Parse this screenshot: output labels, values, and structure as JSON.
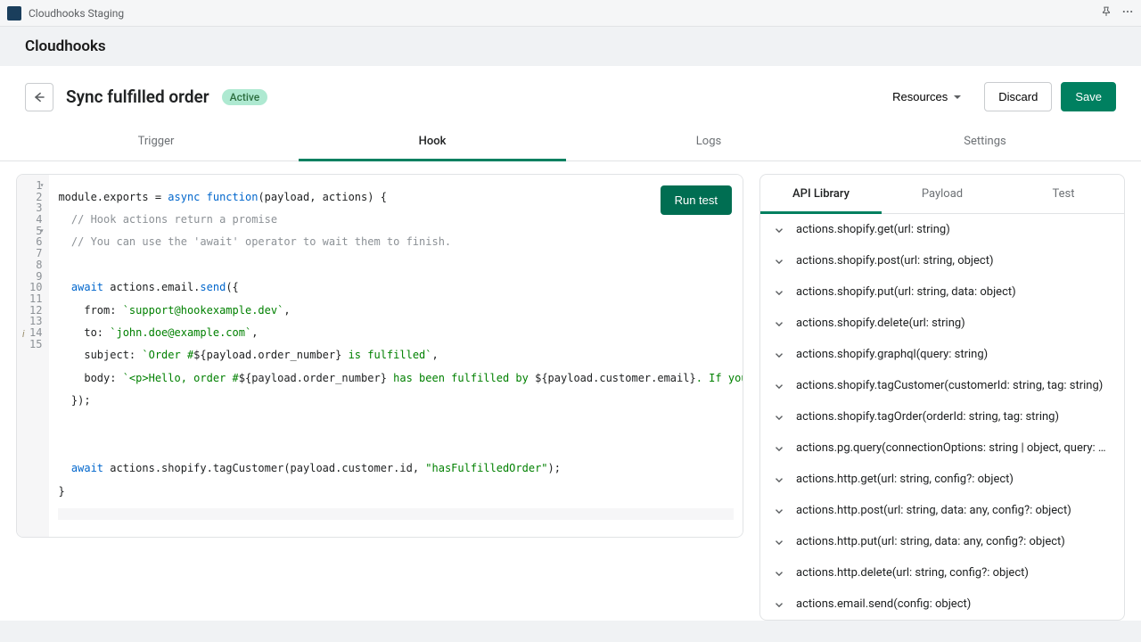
{
  "topbar": {
    "title": "Cloudhooks Staging"
  },
  "app": {
    "title": "Cloudhooks"
  },
  "page": {
    "title": "Sync fulfilled order",
    "badge": "Active",
    "resources": "Resources",
    "discard": "Discard",
    "save": "Save"
  },
  "tabs": {
    "trigger": "Trigger",
    "hook": "Hook",
    "logs": "Logs",
    "settings": "Settings"
  },
  "editor": {
    "run_test": "Run test",
    "lines": [
      "1",
      "2",
      "3",
      "4",
      "5",
      "6",
      "7",
      "8",
      "9",
      "10",
      "11",
      "12",
      "13",
      "14",
      "15"
    ]
  },
  "code": {
    "l1a": "module.exports = ",
    "l1b": "async function",
    "l1c": "(payload, actions) {",
    "l2": "  // Hook actions return a promise",
    "l3": "  // You can use the 'await' operator to wait them to finish.",
    "l5a": "  ",
    "l5await": "await",
    "l5b": " actions.email.",
    "l5send": "send",
    "l5c": "({",
    "l6a": "    from: ",
    "l6b": "`support@hookexample.dev`",
    "l6c": ",",
    "l7a": "    to: ",
    "l7b": "`john.doe@example.com`",
    "l7c": ",",
    "l8a": "    subject: ",
    "l8b": "`Order #",
    "l8c": "${payload.order_number}",
    "l8d": " is fulfilled`",
    "l8e": ",",
    "l9a": "    body: ",
    "l9b": "`<p>Hello, order #",
    "l9c": "${payload.order_number}",
    "l9d": " has been fulfilled by ",
    "l9e": "${payload.customer.email}",
    "l9f": ". If you have questions, please email",
    "l10": "  });",
    "l13a": "  ",
    "l13await": "await",
    "l13b": " actions.shopify.tagCustomer(payload.customer.id, ",
    "l13c": "\"hasFulfilledOrder\"",
    "l13d": ");",
    "l14": "}"
  },
  "side": {
    "api": "API Library",
    "payload": "Payload",
    "test": "Test"
  },
  "api": [
    "actions.shopify.get(url: string)",
    "actions.shopify.post(url: string, object)",
    "actions.shopify.put(url: string, data: object)",
    "actions.shopify.delete(url: string)",
    "actions.shopify.graphql(query: string)",
    "actions.shopify.tagCustomer(customerId: string, tag: string)",
    "actions.shopify.tagOrder(orderId: string, tag: string)",
    "actions.pg.query(connectionOptions: string | object, query: string...",
    "actions.http.get(url: string, config?: object)",
    "actions.http.post(url: string, data: any, config?: object)",
    "actions.http.put(url: string, data: any, config?: object)",
    "actions.http.delete(url: string, config?: object)",
    "actions.email.send(config: object)"
  ]
}
